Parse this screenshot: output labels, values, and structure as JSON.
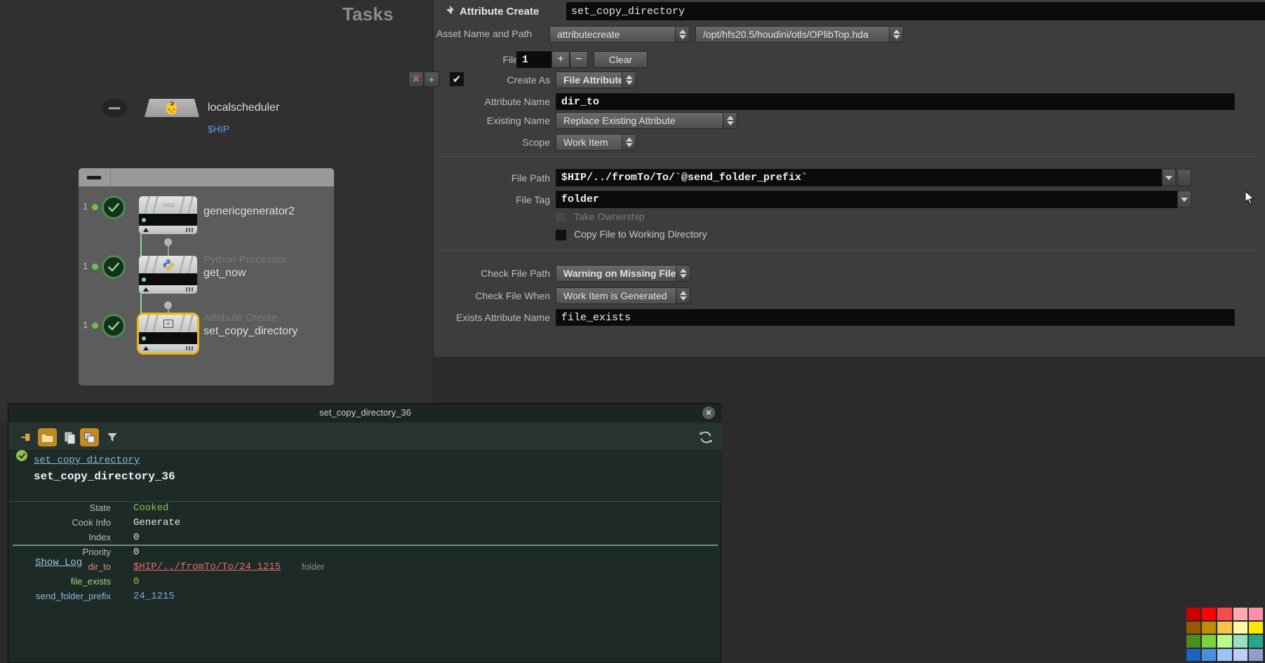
{
  "network": {
    "tasks_label": "Tasks",
    "scheduler": {
      "name": "localscheduler",
      "hip": "$HIP",
      "icon": "scheduler-icon",
      "collapse_icon": "minus-icon"
    },
    "nodes": [
      {
        "type": "",
        "name": "genericgenerator2",
        "count": "1",
        "state": "cooked",
        "icon": "generator-icon"
      },
      {
        "type": "Python Processor",
        "name": "get_now",
        "count": "1",
        "state": "cooked",
        "icon": "python-icon"
      },
      {
        "type": "Attribute Create",
        "name": "set_copy_directory",
        "count": "1",
        "state": "cooked",
        "icon": "attribute-create-icon",
        "selected": true
      }
    ]
  },
  "param": {
    "op_type": "Attribute Create",
    "node_name": "set_copy_directory",
    "header_icons": [
      "pin-icon",
      "gear-icon",
      "brush-icon",
      "search-icon",
      "info-icon"
    ],
    "asset_label": "Asset Name and Path",
    "asset_name": "attributecreate",
    "asset_path": "/opt/hfs20.5/houdini/otls/OPlibTop.hda",
    "files_label": "Files",
    "files_value": "1",
    "files_plus": "+",
    "files_minus": "−",
    "clear_label": "Clear",
    "delete_btn": "✕",
    "insert_btn": "+",
    "multiparm_check": "✔",
    "rows": [
      {
        "label": "Create As",
        "type": "combo",
        "value": "File Attribute",
        "bold": true
      },
      {
        "label": "Attribute Name",
        "type": "field",
        "value": "dir_to"
      },
      {
        "label": "Existing Name",
        "type": "combo",
        "value": "Replace Existing Attribute"
      },
      {
        "label": "Scope",
        "type": "combo",
        "value": "Work Item"
      },
      {
        "label": "File Path",
        "type": "field-drop",
        "value": "$HIP/../fromTo/To/`@send_folder_prefix`"
      },
      {
        "label": "File Tag",
        "type": "field-drop",
        "value": "folder"
      },
      {
        "label": "Take Ownership",
        "type": "checkbox",
        "checked": false,
        "disabled": true
      },
      {
        "label": "Copy File to Working Directory",
        "type": "checkbox",
        "checked": false,
        "disabled": false
      },
      {
        "label": "Check File Path",
        "type": "combo",
        "value": "Warning on Missing File",
        "bold": true
      },
      {
        "label": "Check File When",
        "type": "combo",
        "value": "Work Item is Generated"
      },
      {
        "label": "Exists Attribute Name",
        "type": "field",
        "value": "file_exists"
      }
    ]
  },
  "taskpanel": {
    "title": "set_copy_directory_36",
    "close_icon": "close-icon",
    "toolbar_icons": [
      "pin-icon",
      "folder-icon",
      "copy-pages-icon",
      "copy-squares-icon",
      "filter-icon",
      "refresh-icon"
    ],
    "node_link": "set_copy_directory",
    "work_item": "set_copy_directory_36",
    "state_icon": "check-circle-icon",
    "attributes": [
      {
        "key": "State",
        "value": "Cooked",
        "key_color": "#b9b9b9",
        "value_color": "#8fbf4b"
      },
      {
        "key": "Cook Info",
        "value": "Generate",
        "key_color": "#b9b9b9",
        "value_color": "#e8e8e8"
      },
      {
        "key": "Index",
        "value": "0",
        "key_color": "#b9b9b9",
        "value_color": "#e8e8e8"
      },
      {
        "key": "Priority",
        "value": "0",
        "key_color": "#b9b9b9",
        "value_color": "#e8e8e8"
      },
      {
        "key": "dir_to",
        "value": "$HIP/../fromTo/To/24_1215",
        "suffix": "folder",
        "key_color": "#e08a8a",
        "value_color": "#e46c6c"
      },
      {
        "key": "file_exists",
        "value": "0",
        "key_color": "#9fd28a",
        "value_color": "#8fbf4b"
      },
      {
        "key": "send_folder_prefix",
        "value": "24_1215",
        "key_color": "#8fb8d6",
        "value_color": "#7fa8d8"
      }
    ],
    "show_log": "Show Log"
  },
  "palette": {
    "colors": [
      "#cc0000",
      "#fe0000",
      "#f84a4a",
      "#ffabab",
      "#ff8fa8",
      "#965900",
      "#bf8c04",
      "#f6c44d",
      "#fff9a8",
      "#ffe800",
      "#4c8c1f",
      "#7dd13c",
      "#bcfc8e",
      "#9adfc0",
      "#22a88a",
      "#1b63c4",
      "#4a90e2",
      "#9ac6f5",
      "#bfcffd",
      "#8f9ecb"
    ]
  }
}
